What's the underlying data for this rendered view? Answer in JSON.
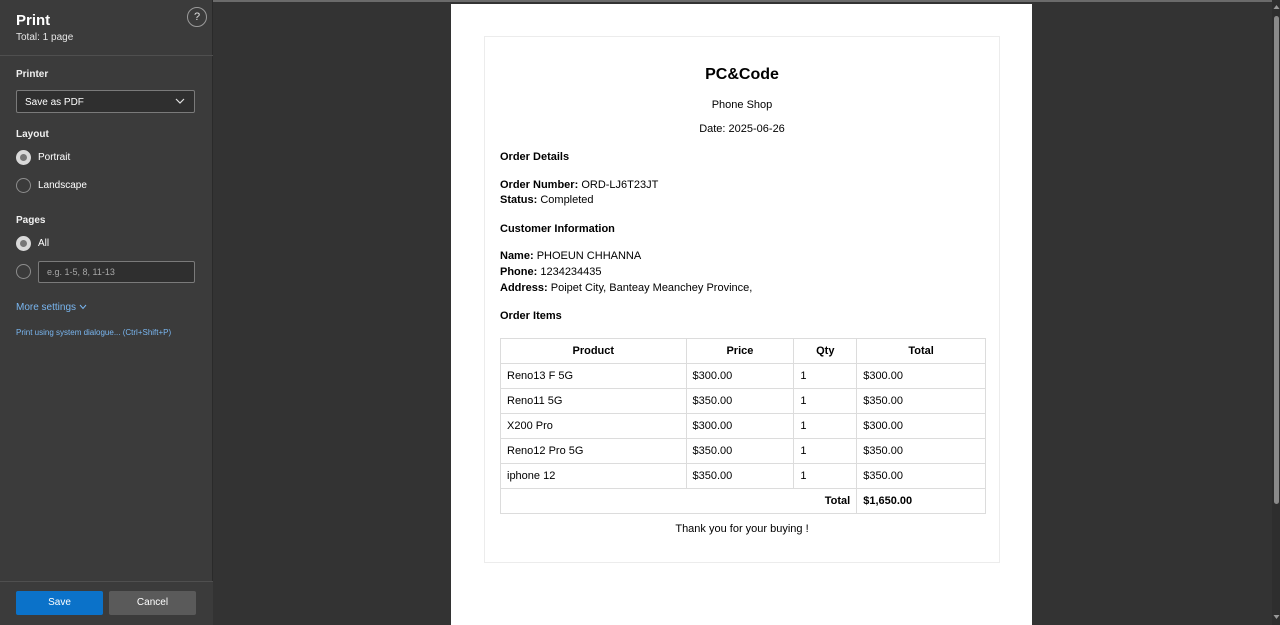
{
  "sidebar": {
    "title": "Print",
    "subtitle": "Total: 1 page",
    "help": "?",
    "printer": {
      "label": "Printer",
      "value": "Save as PDF"
    },
    "layout": {
      "label": "Layout",
      "options": [
        {
          "label": "Portrait",
          "checked": true
        },
        {
          "label": "Landscape",
          "checked": false
        }
      ]
    },
    "pages": {
      "label": "Pages",
      "all_label": "All",
      "custom_placeholder": "e.g. 1-5, 8, 11-13"
    },
    "more_settings": "More settings",
    "system_dialogue": "Print using system dialogue... (Ctrl+Shift+P)",
    "save_label": "Save",
    "cancel_label": "Cancel"
  },
  "receipt": {
    "title": "PC&Code",
    "subtitle": "Phone Shop",
    "date": "Date: 2025-06-26",
    "order_details_heading": "Order Details",
    "order_number_label": "Order Number:",
    "order_number": "ORD-LJ6T23JT",
    "status_label": "Status:",
    "status": "Completed",
    "customer_heading": "Customer Information",
    "name_label": "Name:",
    "name": "PHOEUN CHHANNA",
    "phone_label": "Phone:",
    "phone": "1234234435",
    "address_label": "Address:",
    "address": "Poipet City, Banteay Meanchey Province,",
    "items_heading": "Order Items",
    "columns": [
      "Product",
      "Price",
      "Qty",
      "Total"
    ],
    "rows": [
      [
        "Reno13 F 5G",
        "$300.00",
        "1",
        "$300.00"
      ],
      [
        "Reno11 5G",
        "$350.00",
        "1",
        "$350.00"
      ],
      [
        "X200 Pro",
        "$300.00",
        "1",
        "$300.00"
      ],
      [
        "Reno12 Pro 5G",
        "$350.00",
        "1",
        "$350.00"
      ],
      [
        "iphone 12",
        "$350.00",
        "1",
        "$350.00"
      ]
    ],
    "total_label": "Total",
    "total_value": "$1,650.00",
    "thanks": "Thank you for your buying !"
  }
}
